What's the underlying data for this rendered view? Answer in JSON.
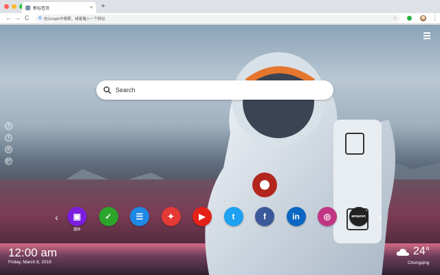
{
  "browser": {
    "tab_title": "新标签页",
    "tab_close": "×",
    "new_tab": "+",
    "back": "←",
    "forward": "→",
    "reload": "C",
    "google_g": "G",
    "omnibox_placeholder": "在Google中搜索，或者输入一个网址",
    "star": "☆",
    "menu": "⋮"
  },
  "search": {
    "placeholder": "Search"
  },
  "side_social": [
    "f",
    "t",
    "p",
    "g+"
  ],
  "shortcuts": {
    "prev": "‹",
    "next": "›",
    "items": [
      {
        "label": "图库",
        "icon": "gallery-icon",
        "color": "#7c1de0",
        "glyph": "▣"
      },
      {
        "label": "",
        "icon": "notes-icon",
        "color": "#2ba52b",
        "glyph": "✓"
      },
      {
        "label": "",
        "icon": "news-icon",
        "color": "#1e88e5",
        "glyph": "☰"
      },
      {
        "label": "",
        "icon": "games-icon",
        "color": "#e53935",
        "glyph": "✦"
      },
      {
        "label": "",
        "icon": "youtube-icon",
        "color": "#e62117",
        "glyph": "▶"
      },
      {
        "label": "",
        "icon": "twitter-icon",
        "color": "#1da1f2",
        "glyph": "t"
      },
      {
        "label": "",
        "icon": "facebook-icon",
        "color": "#3b5998",
        "glyph": "f"
      },
      {
        "label": "",
        "icon": "linkedin-icon",
        "color": "#0a66c2",
        "glyph": "in"
      },
      {
        "label": "",
        "icon": "instagram-icon",
        "color": "#c13584",
        "glyph": "◎"
      },
      {
        "label": "",
        "icon": "amazon-icon",
        "color": "#222222",
        "glyph": "amazon"
      }
    ]
  },
  "clock": {
    "time": "12:00 am",
    "date": "Friday, March 8, 2019"
  },
  "weather": {
    "temp": "24°",
    "city": "Chongqing",
    "icon": "cloud-icon"
  }
}
